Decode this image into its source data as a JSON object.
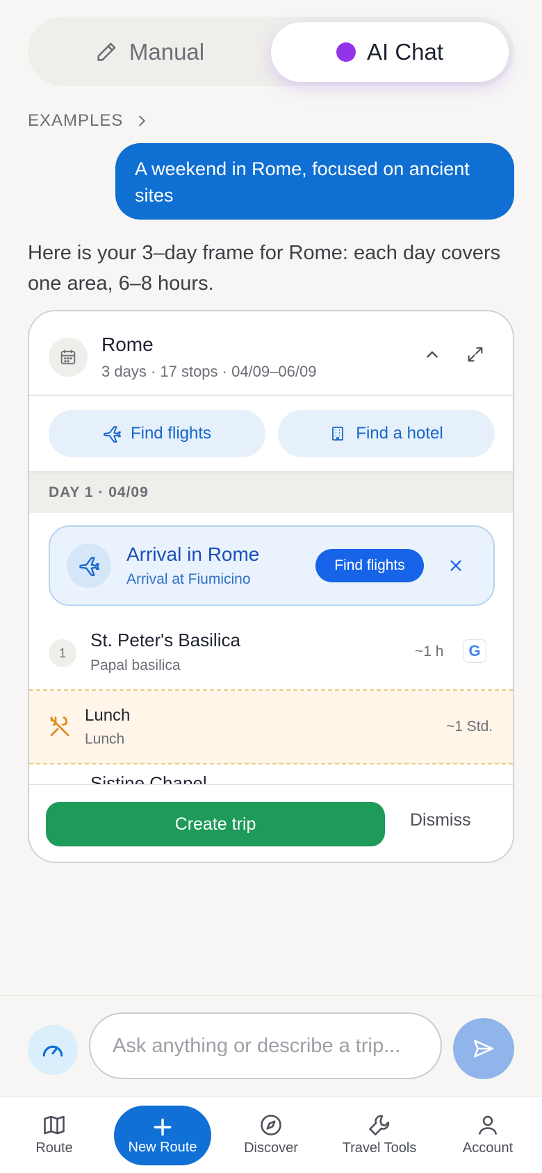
{
  "mode_toggle": {
    "manual_label": "Manual",
    "ai_label": "AI Chat"
  },
  "examples_label": "EXAMPLES",
  "user_message": "A weekend in Rome, focused on ancient sites",
  "assistant_message": "Here is your 3–day frame for Rome: each day covers one area, 6–8 hours.",
  "trip_card": {
    "title": "Rome",
    "subtitle": "3 days · 17 stops · 04/09–06/09",
    "find_flights_label": "Find flights",
    "find_hotel_label": "Find a hotel",
    "day_header": "DAY 1 · 04/09",
    "arrival": {
      "title": "Arrival in Rome",
      "subtitle": "Arrival at Fiumicino",
      "button_label": "Find flights"
    },
    "stops": [
      {
        "number": "1",
        "title": "St. Peter's Basilica",
        "subtitle": "Papal basilica",
        "duration": "~1 h",
        "source_badge": "G"
      }
    ],
    "lunch": {
      "title": "Lunch",
      "subtitle": "Lunch",
      "duration": "~1 Std."
    },
    "next_stop_partial": "Sistine Chapel",
    "create_label": "Create trip",
    "dismiss_label": "Dismiss"
  },
  "composer": {
    "placeholder": "Ask anything or describe a trip..."
  },
  "bottom_nav": {
    "route": "Route",
    "new_route": "New Route",
    "discover": "Discover",
    "travel_tools": "Travel Tools",
    "account": "Account"
  },
  "colors": {
    "primary_blue": "#0f6fd2",
    "create_green": "#1e9a59",
    "ai_dot_purple": "#9333ea",
    "lunch_orange": "#e08a1e"
  }
}
